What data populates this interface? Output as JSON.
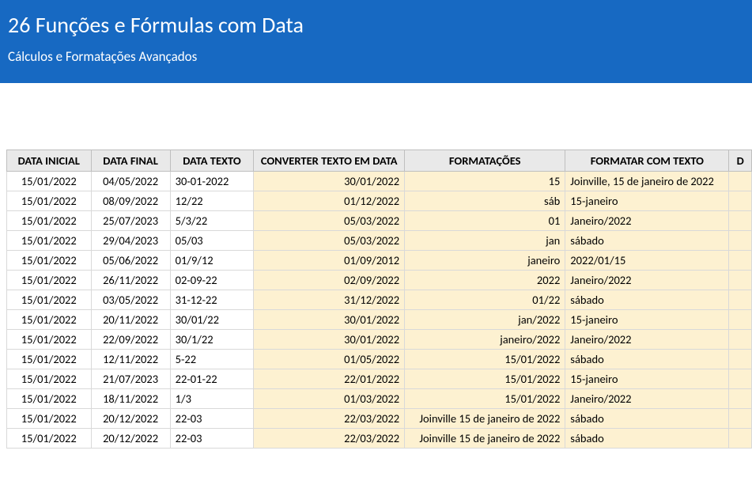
{
  "banner": {
    "title": "26 Funções e Fórmulas com Data",
    "subtitle": "Cálculos e Formatações Avançados"
  },
  "table": {
    "headers": [
      "DATA INICIAL",
      "DATA FINAL",
      "DATA TEXTO",
      "CONVERTER TEXTO EM DATA",
      "FORMATAÇÕES",
      "FORMATAR COM TEXTO",
      "D"
    ],
    "rows": [
      {
        "data_inicial": "15/01/2022",
        "data_final": "04/05/2022",
        "data_texto": "30-01-2022",
        "converter": "30/01/2022",
        "formatacoes": "15",
        "formatar": "Joinville, 15 de janeiro de 2022"
      },
      {
        "data_inicial": "15/01/2022",
        "data_final": "08/09/2022",
        "data_texto": "12/22",
        "converter": "01/12/2022",
        "formatacoes": "sáb",
        "formatar": "15-janeiro"
      },
      {
        "data_inicial": "15/01/2022",
        "data_final": "25/07/2023",
        "data_texto": "5/3/22",
        "converter": "05/03/2022",
        "formatacoes": "01",
        "formatar": "Janeiro/2022"
      },
      {
        "data_inicial": "15/01/2022",
        "data_final": "29/04/2023",
        "data_texto": "05/03",
        "converter": "05/03/2022",
        "formatacoes": "jan",
        "formatar": "sábado"
      },
      {
        "data_inicial": "15/01/2022",
        "data_final": "05/06/2022",
        "data_texto": "01/9/12",
        "converter": "01/09/2012",
        "formatacoes": "janeiro",
        "formatar": "2022/01/15"
      },
      {
        "data_inicial": "15/01/2022",
        "data_final": "26/11/2022",
        "data_texto": "02-09-22",
        "converter": "02/09/2022",
        "formatacoes": "2022",
        "formatar": "Janeiro/2022"
      },
      {
        "data_inicial": "15/01/2022",
        "data_final": "03/05/2022",
        "data_texto": "31-12-22",
        "converter": "31/12/2022",
        "formatacoes": "01/22",
        "formatar": "sábado"
      },
      {
        "data_inicial": "15/01/2022",
        "data_final": "20/11/2022",
        "data_texto": "30/01/22",
        "converter": "30/01/2022",
        "formatacoes": "jan/2022",
        "formatar": "15-janeiro"
      },
      {
        "data_inicial": "15/01/2022",
        "data_final": "22/09/2022",
        "data_texto": "30/1/22",
        "converter": "30/01/2022",
        "formatacoes": "janeiro/2022",
        "formatar": "Janeiro/2022"
      },
      {
        "data_inicial": "15/01/2022",
        "data_final": "12/11/2022",
        "data_texto": "5-22",
        "converter": "01/05/2022",
        "formatacoes": "15/01/2022",
        "formatar": "sábado"
      },
      {
        "data_inicial": "15/01/2022",
        "data_final": "21/07/2023",
        "data_texto": "22-01-22",
        "converter": "22/01/2022",
        "formatacoes": "15/01/2022",
        "formatar": "15-janeiro"
      },
      {
        "data_inicial": "15/01/2022",
        "data_final": "18/11/2022",
        "data_texto": "1/3",
        "converter": "01/03/2022",
        "formatacoes": "15/01/2022",
        "formatar": "Janeiro/2022"
      },
      {
        "data_inicial": "15/01/2022",
        "data_final": "20/12/2022",
        "data_texto": "22-03",
        "converter": "22/03/2022",
        "formatacoes": "Joinville 15 de janeiro de 2022",
        "formatar": "sábado"
      },
      {
        "data_inicial": "15/01/2022",
        "data_final": "20/12/2022",
        "data_texto": "22-03",
        "converter": "22/03/2022",
        "formatacoes": "Joinville 15 de janeiro de 2022",
        "formatar": "sábado"
      }
    ]
  }
}
